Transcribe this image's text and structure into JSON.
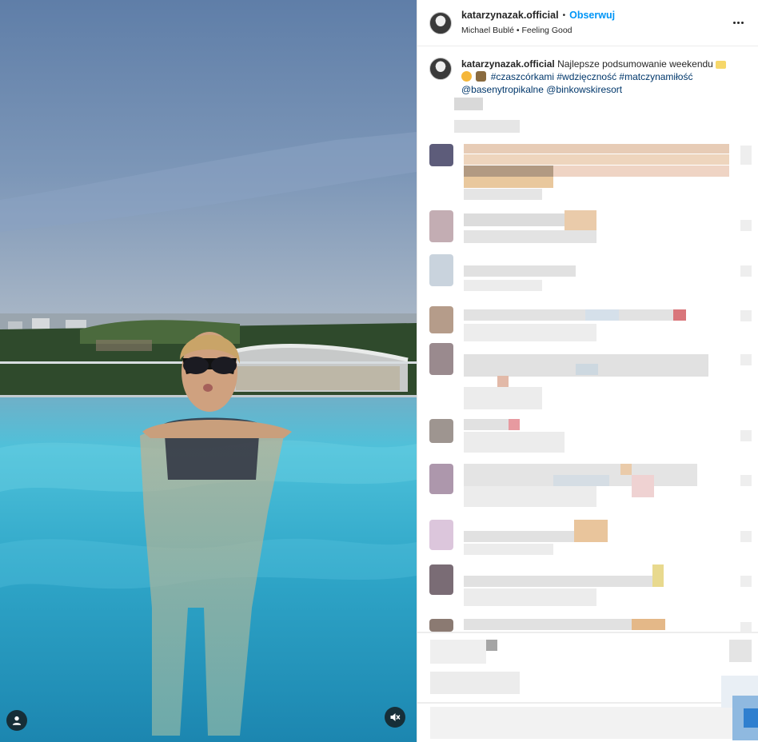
{
  "header": {
    "username": "katarzynazak.official",
    "separator": "•",
    "follow_label": "Obserwuj",
    "music": "Michael Bublé • Feeling Good"
  },
  "caption": {
    "username": "katarzynazak.official",
    "text": "Najlepsze podsumowanie weekendu",
    "hashtags": "#czaszcórkami #wdzięczność #matczynamiłość",
    "mentions": "@basenytropikalne @binkowskiresort"
  },
  "icons": {
    "more": "more-horizontal-icon",
    "user": "user-tag-icon",
    "mute": "audio-muted-icon"
  },
  "colors": {
    "follow": "#0095f6",
    "link": "#00376b",
    "text": "#262626"
  }
}
